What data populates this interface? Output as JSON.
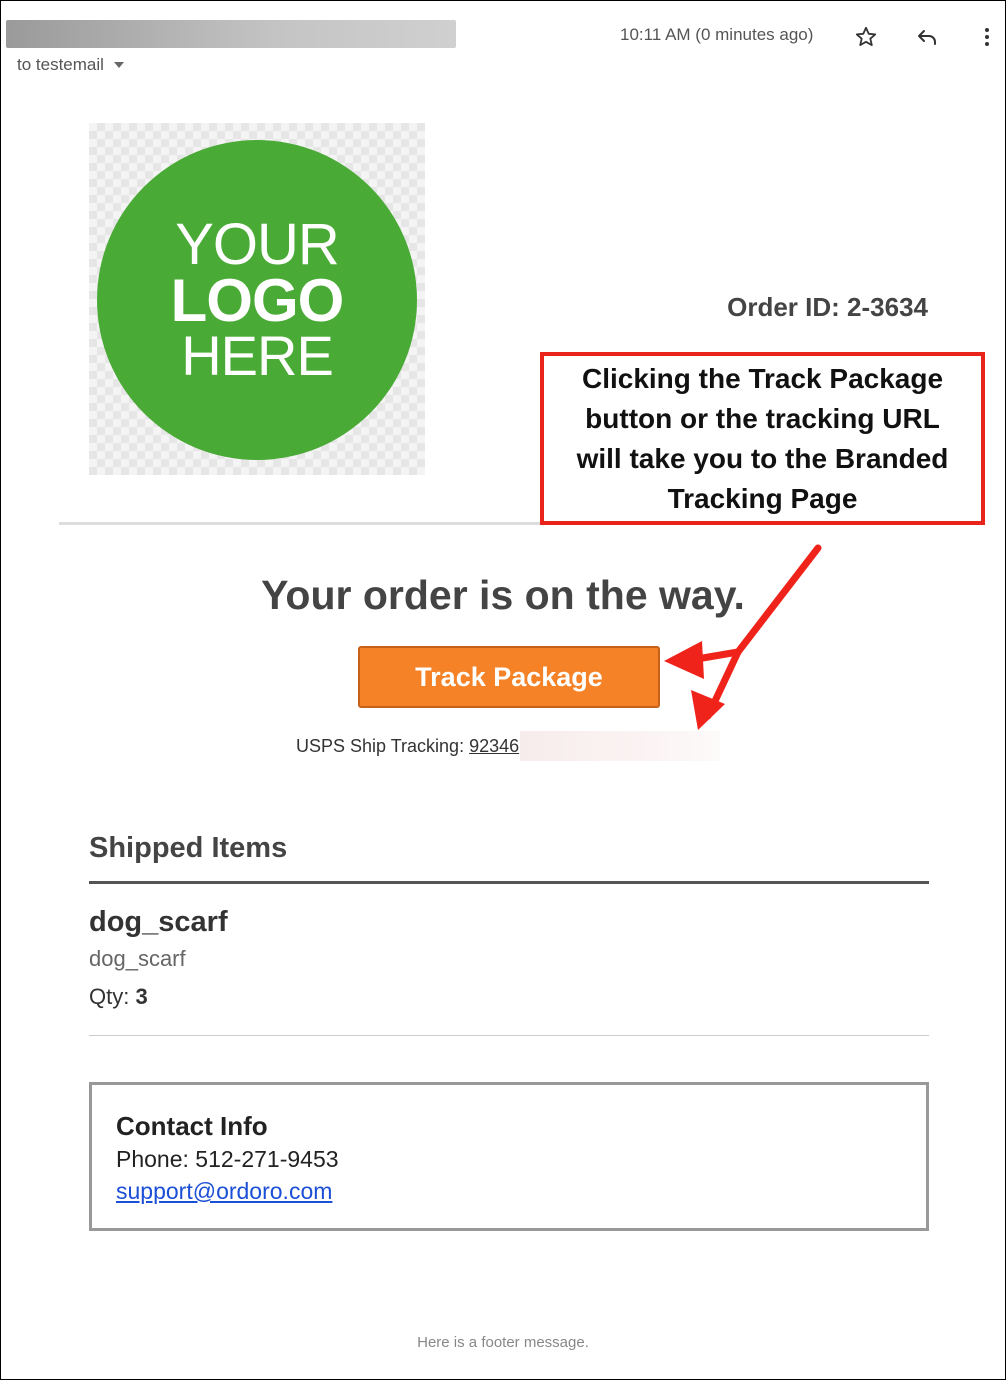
{
  "header": {
    "recipient": "to testemail",
    "timestamp": "10:11 AM (0 minutes ago)"
  },
  "icons": {
    "star": "star-icon",
    "reply": "reply-icon",
    "more": "more-vertical-icon",
    "recipient_dropdown": "caret-down-icon"
  },
  "email": {
    "logo": {
      "line1": "YOUR",
      "line2": "LOGO",
      "line3": "HERE"
    },
    "order_id": "Order ID: 2-3634",
    "headline": "Your order is on the way.",
    "track_button_label": "Track Package",
    "tracking_label": "USPS Ship Tracking:",
    "tracking_number": "92346",
    "shipped_items_title": "Shipped Items",
    "items": [
      {
        "name": "dog_scarf",
        "sku": "dog_scarf",
        "qty_label": "Qty:",
        "qty": "3"
      }
    ],
    "contact": {
      "title": "Contact Info",
      "phone": "Phone: 512-271-9453",
      "email": "support@ordoro.com"
    },
    "footer": "Here is a footer message."
  },
  "annotation": {
    "callout_text": "Clicking the Track Package button or the tracking URL will take you to the Branded Tracking Page"
  },
  "colors": {
    "logo_green": "#4aaa36",
    "button_orange": "#f58226",
    "callout_red": "#e8231a",
    "link_blue": "#1a4fd6"
  }
}
